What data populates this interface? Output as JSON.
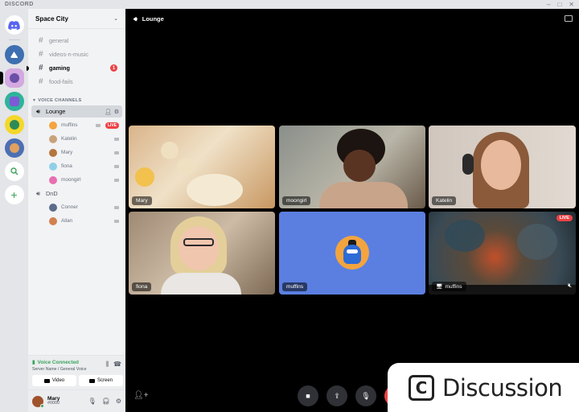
{
  "titlebar": {
    "brand": "DISCORD",
    "controls": [
      "minimize-icon",
      "maximize-icon",
      "close-icon"
    ]
  },
  "servers": [
    {
      "name": "home",
      "icon": "discord-logo-icon"
    },
    {
      "name": "server-1"
    },
    {
      "name": "server-2",
      "selected": true
    },
    {
      "name": "server-3"
    },
    {
      "name": "server-4"
    },
    {
      "name": "server-5"
    },
    {
      "name": "explore",
      "icon": "search-icon"
    },
    {
      "name": "add-server",
      "icon": "plus-icon"
    }
  ],
  "guild": {
    "name": "Space City"
  },
  "text_channels": [
    {
      "name": "general",
      "unread": false
    },
    {
      "name": "videos-n-music",
      "unread": false
    },
    {
      "name": "gaming",
      "unread": true,
      "badge": "1"
    },
    {
      "name": "food-fails",
      "unread": false
    }
  ],
  "voice_category": "VOICE CHANNELS",
  "voice_channels": [
    {
      "name": "Lounge",
      "members": [
        {
          "name": "muffins",
          "live": "LIVE",
          "color": "#f3a43f"
        },
        {
          "name": "Katelin",
          "color": "#c9a27a"
        },
        {
          "name": "Mary",
          "color": "#b5753f"
        },
        {
          "name": "fiona",
          "color": "#8fd0e8"
        },
        {
          "name": "moongirl",
          "color": "#e86fb0"
        }
      ]
    },
    {
      "name": "DnD",
      "members": [
        {
          "name": "Conner",
          "color": "#5b6b8a"
        },
        {
          "name": "Allan",
          "color": "#d2804f"
        }
      ]
    }
  ],
  "voice_panel": {
    "status": "Voice Connected",
    "location": "Server Name / General Voice",
    "video_label": "Video",
    "screen_label": "Screen"
  },
  "user": {
    "name": "Mary",
    "tag": "#0000"
  },
  "stage": {
    "channel": "Lounge",
    "tiles": [
      {
        "name": "Mary"
      },
      {
        "name": "moongirl"
      },
      {
        "name": "Katelin"
      },
      {
        "name": "fiona"
      },
      {
        "name": "muffins"
      },
      {
        "name": "muffins",
        "live": "LIVE"
      }
    ]
  },
  "watermark": {
    "logo": "C",
    "text": "Discussion"
  }
}
